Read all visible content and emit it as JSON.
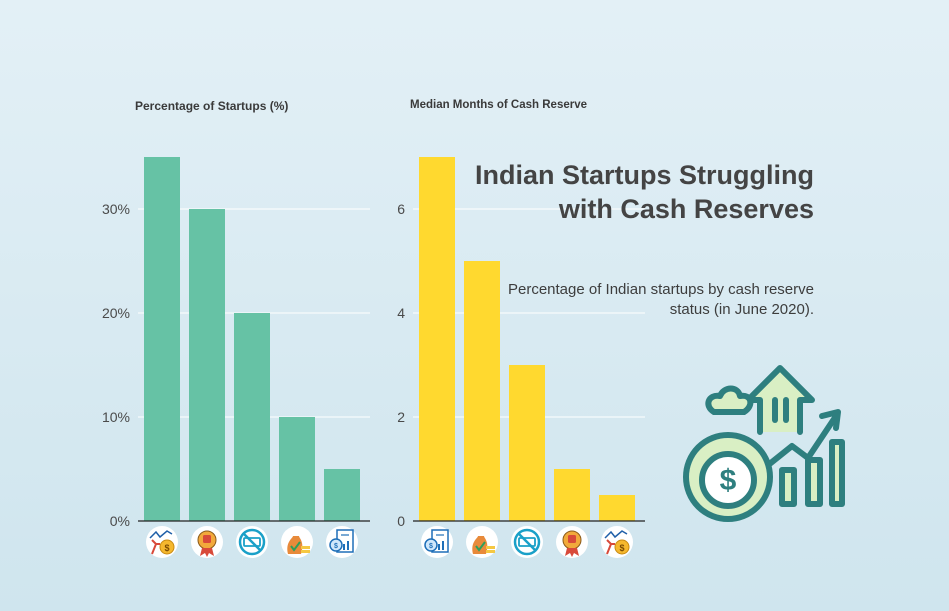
{
  "headline": "Indian Startups Struggling with Cash Reserves",
  "subhead": "Percentage of Indian startups by cash reserve status (in June 2020).",
  "colors": {
    "left_bars": "#66c2a5",
    "right_bars": "#ffd92f",
    "axis": "#222222",
    "grid": "#ffffff",
    "icon_outline": "#2e7f7f",
    "icon_fill": "#d9efc4"
  },
  "chart_data": [
    {
      "type": "bar",
      "title": "Percentage of Startups (%)",
      "categories": [
        "struggling-icon",
        "thumbs-down-badge-icon",
        "no-money-icon",
        "money-bag-coins-icon",
        "financial-report-icon"
      ],
      "values": [
        35,
        30,
        20,
        10,
        5
      ],
      "ylim": [
        0,
        35
      ],
      "yticks": [
        "0%",
        "10%",
        "20%",
        "30%"
      ],
      "ytick_values": [
        0,
        10,
        20,
        30
      ],
      "grid": true
    },
    {
      "type": "bar",
      "title": "Median Months of Cash Reserve",
      "categories": [
        "financial-report-icon",
        "money-bag-coins-icon",
        "no-money-icon",
        "thumbs-down-badge-icon",
        "struggling-icon"
      ],
      "values": [
        7,
        5,
        3,
        1,
        0.5
      ],
      "ylim": [
        0,
        7
      ],
      "yticks": [
        "0",
        "2",
        "4",
        "6"
      ],
      "ytick_values": [
        0,
        2,
        4,
        6
      ],
      "grid": true
    }
  ],
  "illustration_icon": "money-bag-growth-icon"
}
